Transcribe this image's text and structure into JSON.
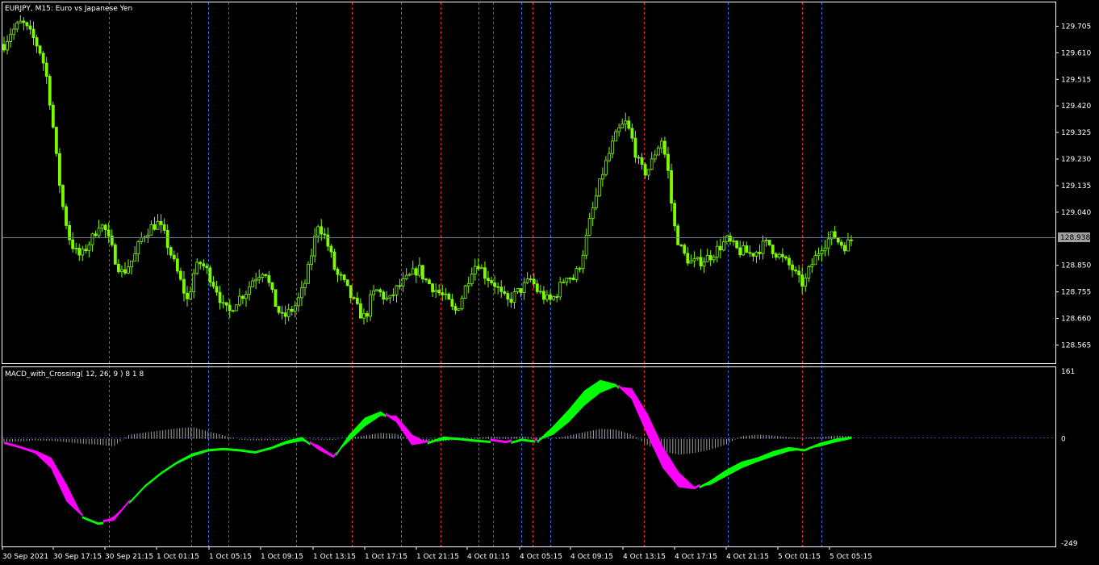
{
  "window": {
    "title": "EURJPY, M15:  Euro vs Japanese Yen",
    "indicator_title": "MACD_with_Crossing( 12, 26, 9 ) 8 1 8"
  },
  "colors": {
    "background": "#000000",
    "frame": "#ffffff",
    "bull_candle": "#7cfc00",
    "macd_up": "#00ff00",
    "macd_down": "#ff00ff",
    "histogram": "#a0a0a0",
    "vline_red": "#ff2020",
    "vline_blue": "#3070ff",
    "price_line": "#708090",
    "price_label_bg": "#a0a0a0"
  },
  "chart_data": [
    {
      "type": "candlestick",
      "title": "EURJPY, M15:  Euro vs Japanese Yen",
      "ylim": [
        128.5,
        129.79
      ],
      "y_ticks": [
        "129.705",
        "129.610",
        "129.515",
        "129.420",
        "129.325",
        "129.230",
        "129.135",
        "129.040",
        "128.850",
        "128.755",
        "128.660",
        "128.565"
      ],
      "current_price": "128.938",
      "x_ticks": [
        "30 Sep 2021",
        "30 Sep 17:15",
        "30 Sep 21:15",
        "1 Oct 01:15",
        "1 Oct 05:15",
        "1 Oct 09:15",
        "1 Oct 13:15",
        "1 Oct 17:15",
        "1 Oct 21:15",
        "4 Oct 01:15",
        "4 Oct 05:15",
        "4 Oct 09:15",
        "4 Oct 13:15",
        "4 Oct 17:15",
        "4 Oct 21:15",
        "5 Oct 01:15",
        "5 Oct 05:15"
      ],
      "close": [
        129.64,
        129.68,
        129.7,
        129.72,
        129.69,
        129.66,
        129.62,
        129.55,
        129.4,
        129.2,
        129.05,
        128.95,
        128.9,
        128.88,
        128.92,
        128.95,
        129.0,
        128.98,
        128.92,
        128.86,
        128.82,
        128.85,
        128.88,
        128.94,
        128.97,
        128.99,
        129.0,
        128.96,
        128.9,
        128.84,
        128.78,
        128.72,
        128.82,
        128.86,
        128.84,
        128.8,
        128.76,
        128.7,
        128.68,
        128.72,
        128.74,
        128.76,
        128.8,
        128.82,
        128.84,
        128.76,
        128.7,
        128.66,
        128.68,
        128.7,
        128.74,
        128.8,
        128.9,
        129.0,
        128.96,
        128.9,
        128.82,
        128.8,
        128.76,
        128.72,
        128.68,
        128.66,
        128.74,
        128.76,
        128.74,
        128.72,
        128.76,
        128.78,
        128.8,
        128.82,
        128.84,
        128.8,
        128.78,
        128.76,
        128.74,
        128.72,
        128.68,
        128.72,
        128.78,
        128.84,
        128.86,
        128.82,
        128.8,
        128.78,
        128.74,
        128.72,
        128.74,
        128.76,
        128.78,
        128.8,
        128.76,
        128.74,
        128.72,
        128.74,
        128.78,
        128.82,
        128.8,
        128.84,
        128.92,
        129.02,
        129.1,
        129.18,
        129.24,
        129.3,
        129.34,
        129.36,
        129.3,
        129.22,
        129.18,
        129.2,
        129.26,
        129.3,
        129.2,
        129.0,
        128.92,
        128.88,
        128.86,
        128.86,
        128.87,
        128.88,
        128.9,
        128.92,
        128.94,
        128.92,
        128.9,
        128.9,
        128.89,
        128.9,
        128.92,
        128.93,
        128.9,
        128.88,
        128.86,
        128.84,
        128.8,
        128.78,
        128.84,
        128.88,
        128.92,
        128.94,
        128.96,
        128.93,
        128.92,
        128.94
      ]
    },
    {
      "type": "line",
      "title": "MACD_with_Crossing( 12, 26, 9 ) 8 1 8",
      "ylim": [
        -249,
        161
      ],
      "y_ticks": [
        "161",
        "0",
        "-249"
      ],
      "series": [
        {
          "values": [
            -12,
            -22,
            -35,
            -70,
            -150,
            -185,
            -200,
            -195,
            -150,
            -110,
            -80,
            -55,
            -35,
            -25,
            -22,
            -25,
            -30,
            -20,
            -5,
            4,
            -25,
            -45,
            10,
            50,
            65,
            40,
            -15,
            -8,
            5,
            2,
            -2,
            -5,
            -10,
            0,
            -5,
            30,
            70,
            115,
            140,
            130,
            95,
            10,
            -70,
            -115,
            -120,
            -100,
            -75,
            -55,
            -45,
            -30,
            -20,
            -25,
            -10,
            0,
            5
          ]
        },
        {
          "values": [
            -10,
            -20,
            -28,
            -45,
            -110,
            -185,
            -205,
            -185,
            -150,
            -115,
            -85,
            -60,
            -42,
            -30,
            -25,
            -28,
            -30,
            -25,
            -12,
            -5,
            -15,
            -40,
            -5,
            30,
            55,
            55,
            10,
            -10,
            -3,
            0,
            -3,
            -5,
            -8,
            -3,
            -4,
            10,
            40,
            80,
            110,
            125,
            120,
            60,
            -20,
            -80,
            -115,
            -110,
            -90,
            -70,
            -55,
            -42,
            -30,
            -25,
            -18,
            -8,
            0
          ]
        },
        {
          "values": [
            -8,
            -6,
            -4,
            -5,
            -8,
            -12,
            -14,
            -18,
            10,
            15,
            20,
            25,
            28,
            18,
            8,
            -2,
            -4,
            -3,
            -2,
            -1,
            -2,
            -3,
            2,
            8,
            14,
            12,
            -4,
            -10,
            -6,
            -2,
            3,
            5,
            4,
            6,
            3,
            0,
            8,
            16,
            24,
            22,
            10,
            -15,
            -30,
            -38,
            -34,
            -26,
            -14,
            6,
            10,
            8,
            4,
            2,
            4,
            8,
            6
          ]
        }
      ]
    }
  ]
}
